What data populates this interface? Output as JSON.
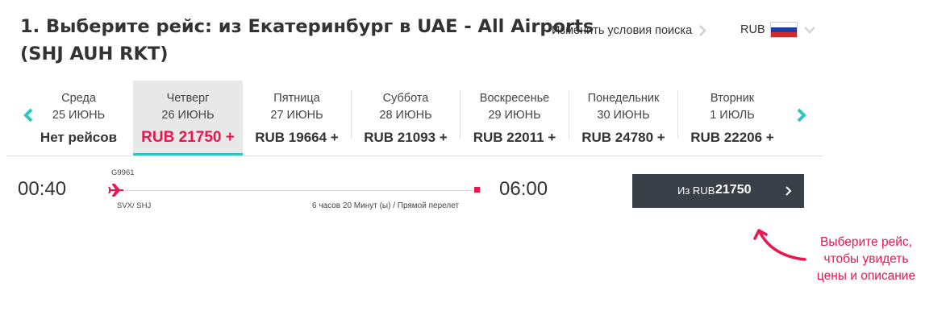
{
  "header": {
    "title_line1": "1. Выберите рейс: из Екатеринбург в UAE - All Airports",
    "title_line2": "(SHJ AUH RKT)",
    "change_search_label": "Изменить условия поиска",
    "currency": "RUB",
    "flag_icon": "russia-flag-icon"
  },
  "colors": {
    "accent_teal": "#2ec4c4",
    "accent_pink": "#e8174f",
    "button_dark": "#3a4047",
    "selected_bg": "#e8e8e8"
  },
  "days": [
    {
      "name": "Среда",
      "date": "25 ИЮНЬ",
      "price": "Нет рейсов"
    },
    {
      "name": "Четверг",
      "date": "26 ИЮНЬ",
      "price": "RUB 21750 +",
      "selected": true
    },
    {
      "name": "Пятница",
      "date": "27 ИЮНЬ",
      "price": "RUB 19664 +"
    },
    {
      "name": "Суббота",
      "date": "28 ИЮНЬ",
      "price": "RUB 21093 +"
    },
    {
      "name": "Воскресенье",
      "date": "29 ИЮНЬ",
      "price": "RUB 22011 +"
    },
    {
      "name": "Понедельник",
      "date": "30 ИЮНЬ",
      "price": "RUB 24780 +"
    },
    {
      "name": "Вторник",
      "date": "1 ИЮЛЬ",
      "price": "RUB 22206 +"
    }
  ],
  "flight": {
    "code": "G9961",
    "departure_time": "00:40",
    "arrival_time": "06:00",
    "route": "SVX/ SHJ",
    "duration": "6 часов 20 Минут (ы) / Прямой перелет",
    "button_prefix": "Из RUB",
    "button_price": "21750"
  },
  "hint": {
    "line1": "Выберите рейс,",
    "line2": "чтобы увидеть",
    "line3": "цены и описание"
  }
}
